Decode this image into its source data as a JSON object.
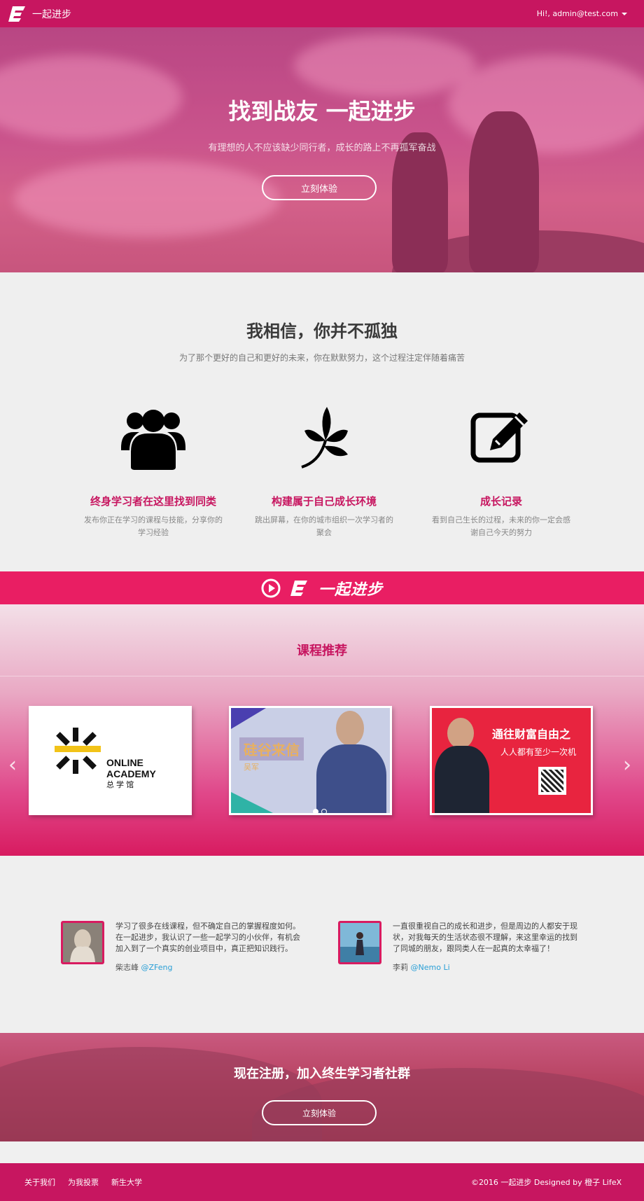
{
  "colors": {
    "brand": "#c71660",
    "banner": "#e91e63",
    "link": "#2a9fd6"
  },
  "navbar": {
    "brand_name": "一起进步",
    "user_label": "Hi!, admin@test.com"
  },
  "hero": {
    "title": "找到战友 一起进步",
    "subtitle": "有理想的人不应该缺少同行者，成长的路上不再孤军奋战",
    "cta_label": "立刻体验"
  },
  "believe": {
    "title": "我相信，你并不孤独",
    "lead": "为了那个更好的自己和更好的未来，你在默默努力，这个过程注定伴随着痛苦",
    "features": [
      {
        "icon": "users-icon",
        "title": "终身学习者在这里找到同类",
        "desc": "发布你正在学习的课程与技能，分享你的学习经验"
      },
      {
        "icon": "leaf-icon",
        "title": "构建属于自己成长环境",
        "desc": "跳出屏幕，在你的城市组织一次学习者的聚会"
      },
      {
        "icon": "edit-icon",
        "title": "成长记录",
        "desc": "看到自己生长的过程，未来的你一定会感谢自己今天的努力"
      }
    ]
  },
  "banner": {
    "text": "一起进步"
  },
  "courses": {
    "title": "课程推荐",
    "cards": [
      {
        "line1": "ONLINE",
        "line2": "ACADEMY",
        "line3": "总 学 馆"
      },
      {
        "title": "硅谷来信",
        "author": "吴军"
      },
      {
        "title": "通往财富自由之",
        "subtitle": "人人都有至少一次机"
      }
    ],
    "slides_count": 2,
    "active_slide": 1
  },
  "testimonials": [
    {
      "text": "学习了很多在线课程，但不确定自己的掌握程度如何。在一起进步，我认识了一些一起学习的小伙伴，有机会加入到了一个真实的创业项目中，真正把知识践行。",
      "name": "柴志峰",
      "handle": "@ZFeng"
    },
    {
      "text": "一直很重视自己的成长和进步，但是周边的人都安于现状，对我每天的生活状态很不理解，来这里幸运的找到了同城的朋友，跟同类人在一起真的太幸福了！",
      "name": "李莉",
      "handle": "@Nemo Li"
    }
  ],
  "cta": {
    "title": "现在注册，加入终生学习者社群",
    "button_label": "立刻体验"
  },
  "footer": {
    "links": [
      "关于我们",
      "为我投票",
      "新生大学"
    ],
    "copyright": "©2016 一起进步 Designed by 橙子 LifeX"
  }
}
